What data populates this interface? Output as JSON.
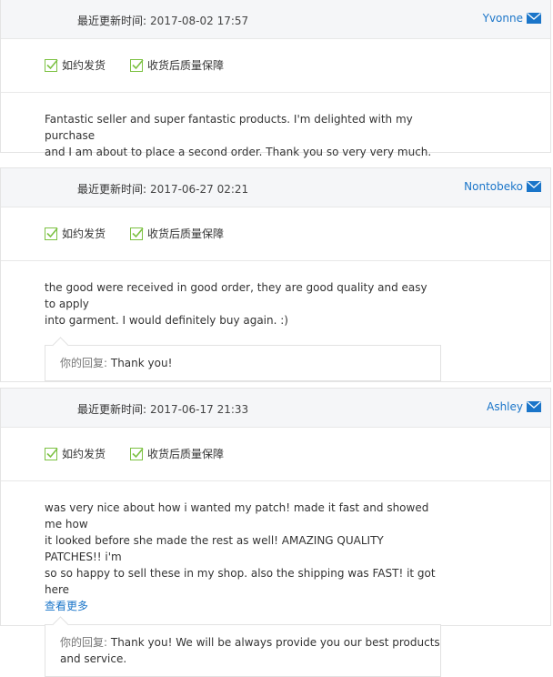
{
  "labels": {
    "updated": "最近更新时间:",
    "badge1": "如约发货",
    "badge2": "收货后质量保障",
    "reply": "你的回复:",
    "more": "查看更多"
  },
  "icons": {
    "mail": "mail-icon",
    "check": "check-icon"
  },
  "colors": {
    "link": "#1a75c9",
    "check": "#7cc142",
    "header_bg": "#f5f6f8"
  },
  "reviews": [
    {
      "date": "2017-08-02 17:57",
      "user": "Yvonne",
      "comment_lines": [
        "Fantastic seller and super fantastic products. I'm delighted with my purchase",
        "and I am about to place a second order. Thank you so very very much."
      ]
    },
    {
      "date": "2017-06-27 02:21",
      "user": "Nontobeko",
      "comment_lines": [
        "the good were received in good order, they are good quality and easy to apply",
        "into garment. I would definitely buy again. :)"
      ],
      "reply_lines": [
        "Thank you!"
      ]
    },
    {
      "date": "2017-06-17 21:33",
      "user": "Ashley",
      "comment_lines": [
        "was very nice about how i wanted my patch! made it fast and showed me how",
        "it looked before she made the rest as well! AMAZING QUALITY PATCHES!! i'm",
        "so so happy to sell these in my shop. also the shipping was FAST! it got here"
      ],
      "reply_lines": [
        "Thank you! We will be always provide you our best products",
        "and service."
      ]
    }
  ]
}
